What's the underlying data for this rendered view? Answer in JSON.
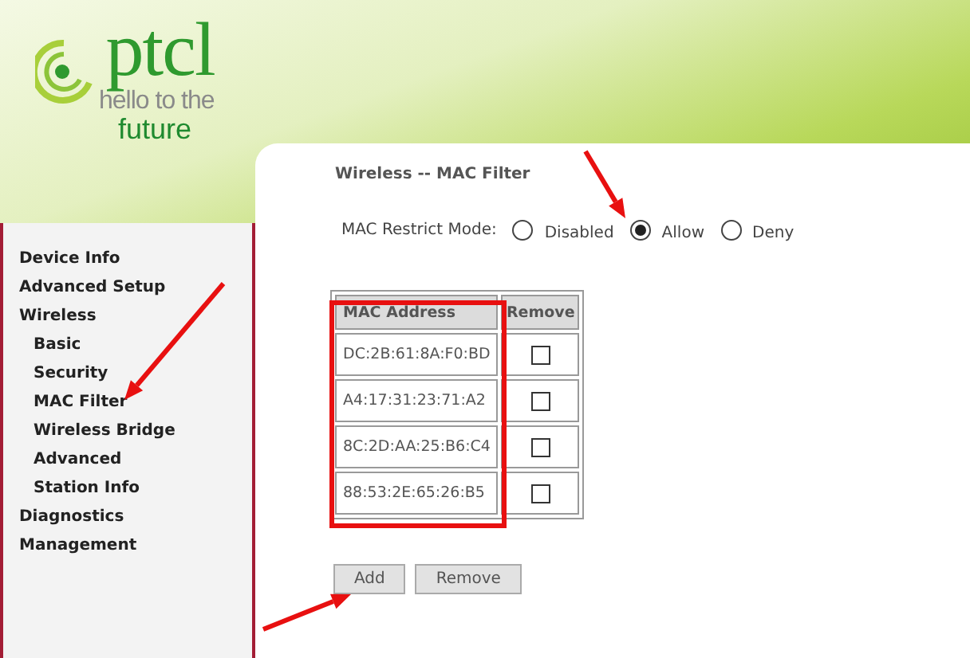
{
  "logo": {
    "brand": "ptcl",
    "tagline": "hello to the",
    "tagline_2": "future"
  },
  "sidebar": {
    "items": [
      {
        "label": "Device Info"
      },
      {
        "label": "Advanced Setup"
      },
      {
        "label": "Wireless",
        "children": [
          {
            "label": "Basic"
          },
          {
            "label": "Security"
          },
          {
            "label": "MAC Filter"
          },
          {
            "label": "Wireless Bridge"
          },
          {
            "label": "Advanced"
          },
          {
            "label": "Station Info"
          }
        ]
      },
      {
        "label": "Diagnostics"
      },
      {
        "label": "Management"
      }
    ]
  },
  "page": {
    "title": "Wireless -- MAC Filter",
    "restrict_mode": {
      "label": "MAC Restrict Mode:",
      "options": [
        {
          "label": "Disabled",
          "selected": false
        },
        {
          "label": "Allow",
          "selected": true
        },
        {
          "label": "Deny",
          "selected": false
        }
      ]
    },
    "table": {
      "columns": [
        "MAC Address",
        "Remove"
      ],
      "rows": [
        {
          "mac": "DC:2B:61:8A:F0:BD",
          "remove_checked": false
        },
        {
          "mac": "A4:17:31:23:71:A2",
          "remove_checked": false
        },
        {
          "mac": "8C:2D:AA:25:B6:C4",
          "remove_checked": false
        },
        {
          "mac": "88:53:2E:65:26:B5",
          "remove_checked": false
        }
      ]
    },
    "buttons": [
      "Add",
      "Remove"
    ]
  }
}
